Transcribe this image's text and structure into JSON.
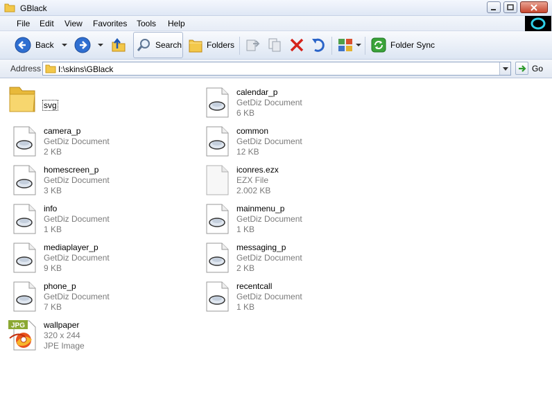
{
  "window": {
    "title": "GBlack"
  },
  "menu": {
    "items": [
      "File",
      "Edit",
      "View",
      "Favorites",
      "Tools",
      "Help"
    ]
  },
  "toolbar": {
    "back_label": "Back",
    "search_label": "Search",
    "folders_label": "Folders",
    "folder_sync_label": "Folder Sync"
  },
  "address": {
    "label": "Address",
    "path": "I:\\skins\\GBlack",
    "go_label": "Go"
  },
  "files": [
    {
      "name": "svg",
      "type": "",
      "size": "",
      "icon": "folder-icon"
    },
    {
      "name": "calendar_p",
      "type": "GetDiz Document",
      "size": "6 KB",
      "icon": "getdiz-document-icon"
    },
    {
      "name": "camera_p",
      "type": "GetDiz Document",
      "size": "2 KB",
      "icon": "getdiz-document-icon"
    },
    {
      "name": "common",
      "type": "GetDiz Document",
      "size": "12 KB",
      "icon": "getdiz-document-icon"
    },
    {
      "name": "homescreen_p",
      "type": "GetDiz Document",
      "size": "3 KB",
      "icon": "getdiz-document-icon"
    },
    {
      "name": "iconres.ezx",
      "type": "EZX File",
      "size": "2.002 KB",
      "icon": "blank-file-icon"
    },
    {
      "name": "info",
      "type": "GetDiz Document",
      "size": "1 KB",
      "icon": "getdiz-document-icon"
    },
    {
      "name": "mainmenu_p",
      "type": "GetDiz Document",
      "size": "1 KB",
      "icon": "getdiz-document-icon"
    },
    {
      "name": "mediaplayer_p",
      "type": "GetDiz Document",
      "size": "9 KB",
      "icon": "getdiz-document-icon"
    },
    {
      "name": "messaging_p",
      "type": "GetDiz Document",
      "size": "2 KB",
      "icon": "getdiz-document-icon"
    },
    {
      "name": "phone_p",
      "type": "GetDiz Document",
      "size": "7 KB",
      "icon": "getdiz-document-icon"
    },
    {
      "name": "recentcall",
      "type": "GetDiz Document",
      "size": "1 KB",
      "icon": "getdiz-document-icon"
    },
    {
      "name": "wallpaper",
      "type": "320 x 244",
      "size": "JPE Image",
      "icon": "jpg-image-icon"
    }
  ],
  "jpg_badge": "JPG"
}
